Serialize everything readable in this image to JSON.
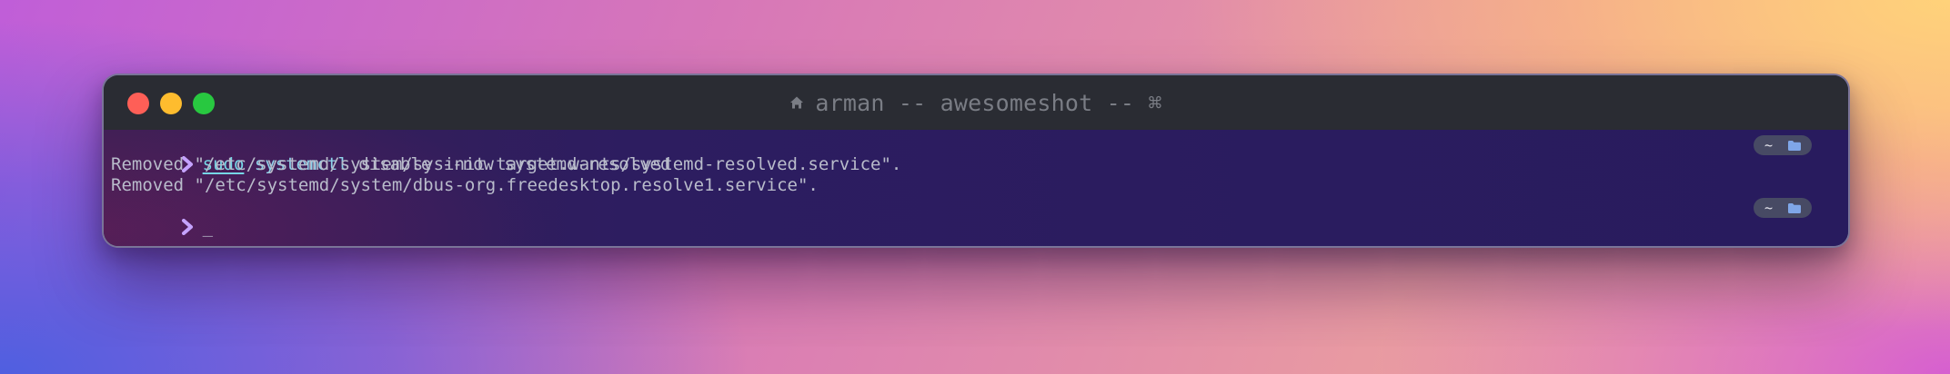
{
  "window": {
    "title": "arman -- awesomeshot -- ⌘"
  },
  "terminal": {
    "lines": [
      {
        "type": "prompt",
        "command": "sudo",
        "program": "systemctl",
        "args": "disable --now systemd-resolved"
      },
      {
        "type": "output",
        "text": "Removed \"/etc/systemd/system/sysinit.target.wants/systemd-resolved.service\"."
      },
      {
        "type": "output",
        "text": "Removed \"/etc/systemd/system/dbus-org.freedesktop.resolve1.service\"."
      },
      {
        "type": "prompt",
        "cursor": "_"
      }
    ],
    "right_prompt": {
      "dir": "~",
      "icon": "folder-icon"
    }
  },
  "colors": {
    "close": "#fe5f57",
    "minimize": "#febc2e",
    "maximize": "#28c840",
    "prompt_chevron": "#c5a3ff",
    "command": "#76d6e6"
  }
}
